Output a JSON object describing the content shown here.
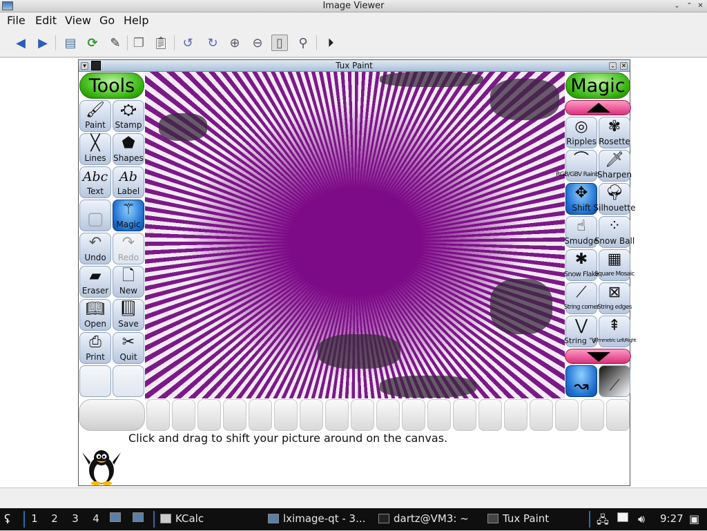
{
  "window": {
    "title": "Image Viewer",
    "controls": [
      "⌄",
      "⌃",
      "✕"
    ]
  },
  "menu": [
    "File",
    "Edit",
    "View",
    "Go",
    "Help"
  ],
  "toolbar_icons": [
    "back-icon",
    "forward-icon",
    "open-icon",
    "reload-icon",
    "edit-icon",
    "copy-icon",
    "paste-icon",
    "rotate-left-icon",
    "rotate-right-icon",
    "zoom-in-icon",
    "zoom-out-icon",
    "fit-icon",
    "original-size-icon",
    "slideshow-icon"
  ],
  "tuxpaint": {
    "title": "Tux Paint",
    "tools_header": "Tools",
    "magic_header": "Magic",
    "tools": [
      "Paint",
      "Stamp",
      "Lines",
      "Shapes",
      "Text",
      "Label",
      "",
      "Magic",
      "Undo",
      "Redo",
      "Eraser",
      "New",
      "Open",
      "Save",
      "Print",
      "Quit"
    ],
    "magic": [
      "Ripples",
      "Rosette",
      "RGB/GBV Rainbow",
      "Sharpen",
      "Shift",
      "Silhouette",
      "Smudge",
      "Snow Ball",
      "Snow Flake",
      "Square Mosaic",
      "String corner",
      "String edges",
      "String 'V'",
      "Symmetric Left/Right"
    ],
    "tip": "Click and drag to shift your picture around on the canvas."
  },
  "taskbar": {
    "desktops": [
      "1",
      "2",
      "3",
      "4"
    ],
    "apps": [
      "KCalc",
      "lximage-qt - 3...",
      "dartz@VM3: ~",
      "Tux Paint"
    ],
    "clock": "9:27"
  }
}
